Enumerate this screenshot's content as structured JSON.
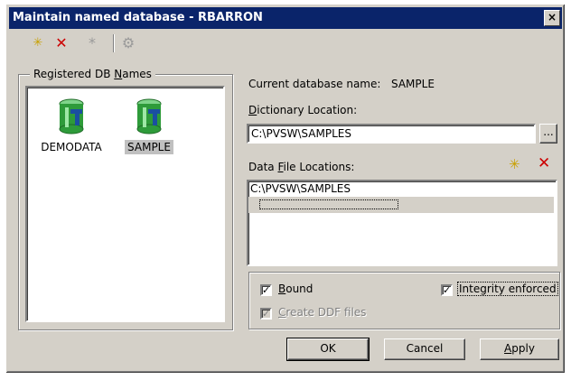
{
  "window": {
    "title": "Maintain named database - RBARRON",
    "close_glyph": "×"
  },
  "toolbar": {
    "items": [
      {
        "icon": "new-icon",
        "glyph": "✳"
      },
      {
        "icon": "delete-icon",
        "glyph": "✕"
      },
      {
        "icon": "asterisk-icon",
        "glyph": "*"
      },
      {
        "icon": "gears-icon",
        "glyph": "⚙"
      }
    ]
  },
  "registered": {
    "legend_pre": "Registered DB ",
    "legend_accel": "N",
    "legend_post": "ames",
    "items": [
      {
        "label": "DEMODATA",
        "selected": false
      },
      {
        "label": "SAMPLE",
        "selected": true
      }
    ]
  },
  "details": {
    "current_label": "Current database name:",
    "current_value": "SAMPLE",
    "dict_accel": "D",
    "dict_rest": "ictionary Location:",
    "dict_value": "C:\\PVSW\\SAMPLES",
    "browse_label": "...",
    "files_pre": "Data ",
    "files_accel": "F",
    "files_post": "ile Locations:",
    "file_locations": [
      "C:\\PVSW\\SAMPLES"
    ]
  },
  "options": {
    "bound_accel": "B",
    "bound_rest": "ound",
    "bound_checked": "✓",
    "integrity_label": "Integrity enforced",
    "integrity_checked": "✓",
    "create_accel": "C",
    "create_rest": "reate DDF files",
    "create_checked": "✓"
  },
  "buttons": {
    "ok": "OK",
    "cancel": "Cancel",
    "apply_accel": "A",
    "apply_rest": "pply"
  },
  "colors": {
    "titlebar": "#0a246a",
    "face": "#d4d0c8",
    "db_icon": "#2e9b3a",
    "delete_red": "#cc0000"
  }
}
